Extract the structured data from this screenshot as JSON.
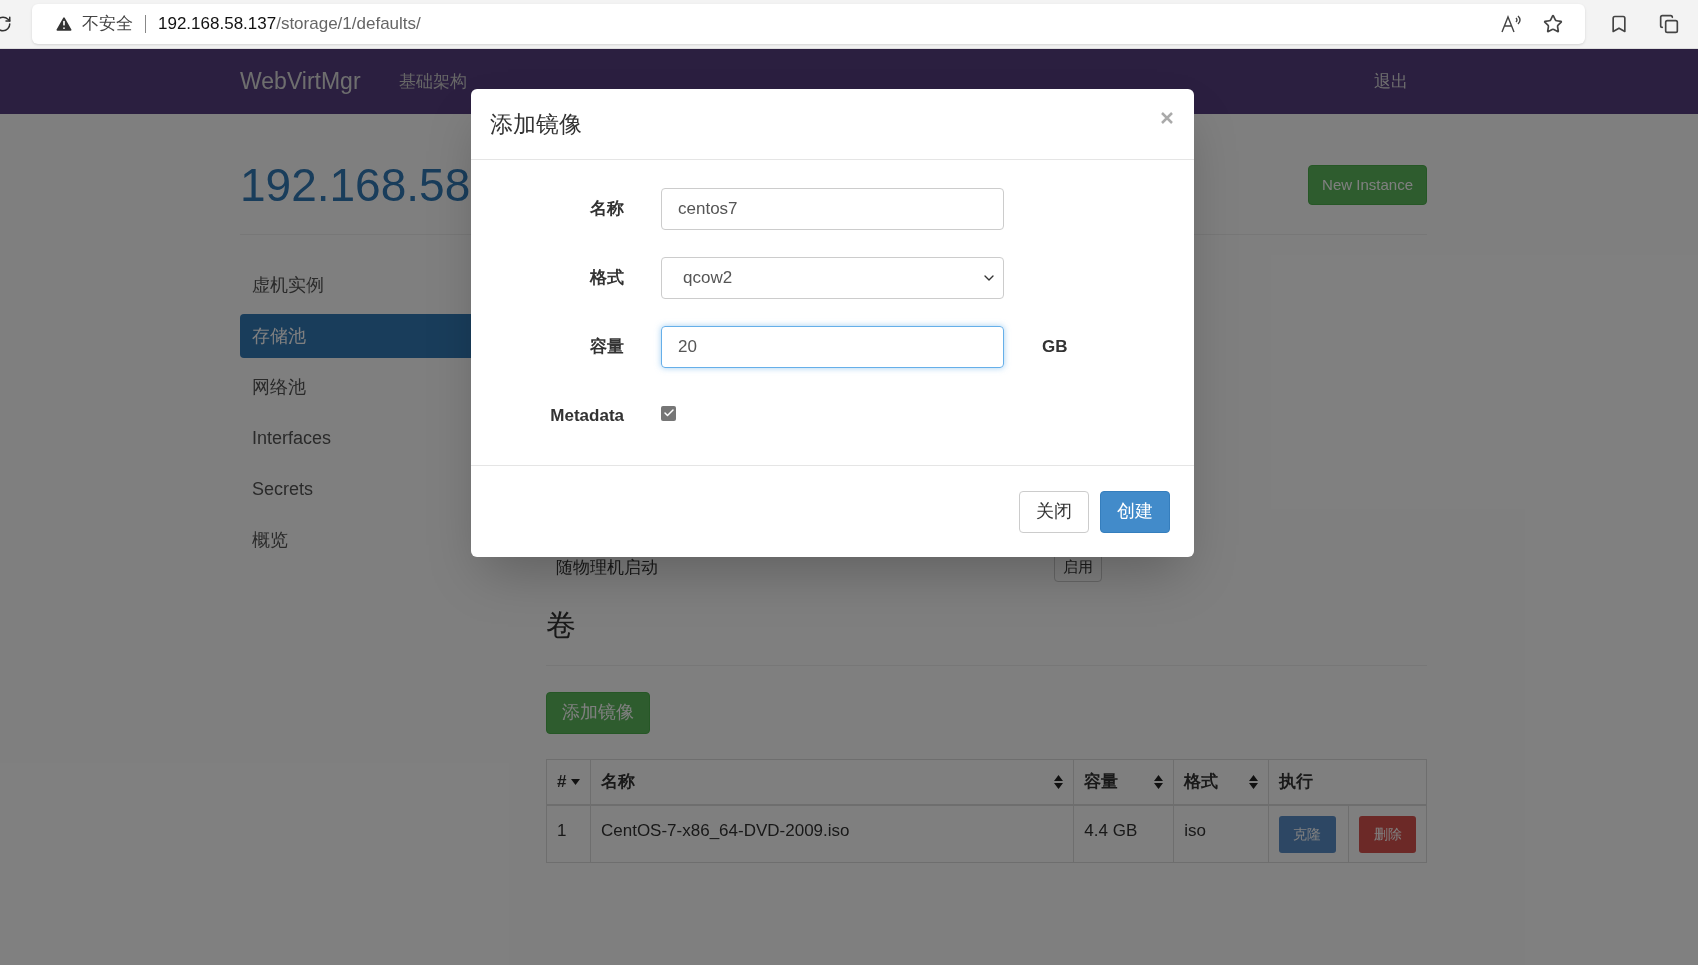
{
  "browser": {
    "security": "不安全",
    "url_host": "192.168.58.137",
    "url_path": "/storage/1/defaults/"
  },
  "navbar": {
    "brand": "WebVirtMgr",
    "links": [
      "基础架构"
    ],
    "logout": "退出"
  },
  "page": {
    "title": "192.168.58",
    "new_instance": "New Instance"
  },
  "sidebar": {
    "items": [
      {
        "label": "虚机实例",
        "selected": false
      },
      {
        "label": "存储池",
        "selected": true
      },
      {
        "label": "网络池",
        "selected": false
      },
      {
        "label": "Interfaces",
        "selected": false
      },
      {
        "label": "Secrets",
        "selected": false
      },
      {
        "label": "概览",
        "selected": false
      }
    ]
  },
  "autostart": {
    "label": "随物理机启动",
    "button": "启用"
  },
  "volumes": {
    "heading": "卷",
    "add_button": "添加镜像",
    "table": {
      "columns": [
        {
          "label": "#",
          "sortable": true,
          "sorted": true
        },
        {
          "label": "名称",
          "sortable": true,
          "sorted": false
        },
        {
          "label": "容量",
          "sortable": true,
          "sorted": false
        },
        {
          "label": "格式",
          "sortable": true,
          "sorted": false
        },
        {
          "label": "执行",
          "sortable": false
        }
      ],
      "rows": [
        {
          "index": "1",
          "name": "CentOS-7-x86_64-DVD-2009.iso",
          "size": "4.4 GB",
          "format": "iso",
          "clone": "克隆",
          "delete": "删除"
        }
      ]
    }
  },
  "modal": {
    "title": "添加镜像",
    "fields": [
      {
        "kind": "text",
        "label": "名称",
        "value": "centos7"
      },
      {
        "kind": "select",
        "label": "格式",
        "value": "qcow2"
      },
      {
        "kind": "text",
        "label": "容量",
        "value": "20",
        "unit": "GB",
        "focused": true
      },
      {
        "kind": "checkbox",
        "label": "Metadata",
        "checked": true
      }
    ],
    "buttons": [
      {
        "label": "关闭",
        "kind": "default"
      },
      {
        "label": "创建",
        "kind": "primary"
      }
    ]
  }
}
